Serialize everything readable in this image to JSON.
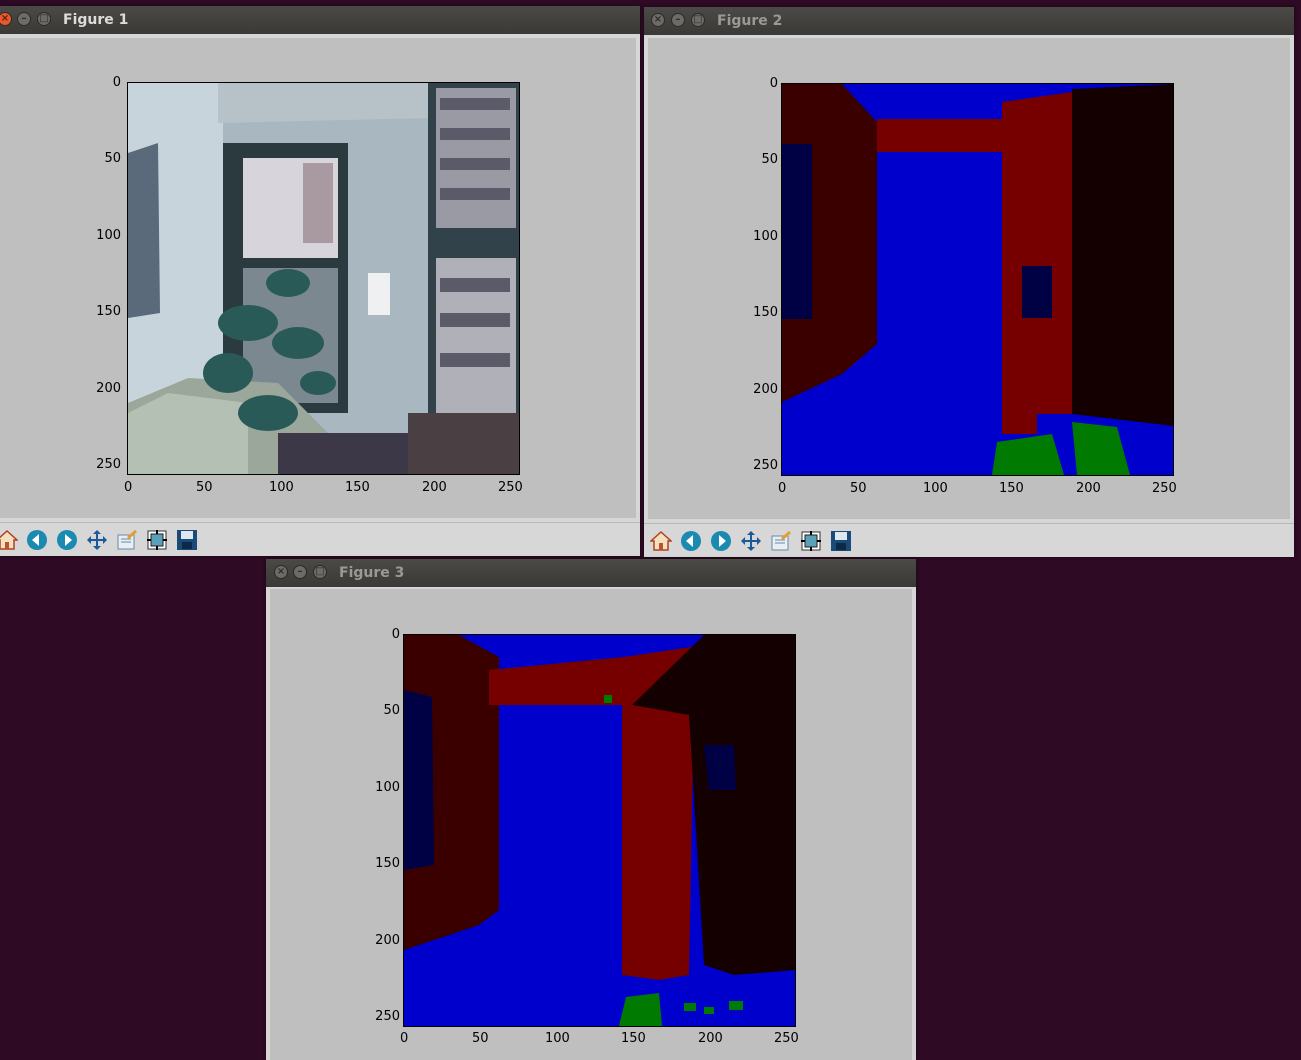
{
  "windows": [
    {
      "title": "Figure 1"
    },
    {
      "title": "Figure 2"
    },
    {
      "title": "Figure 3"
    }
  ],
  "axis": {
    "x_ticks": [
      "0",
      "50",
      "100",
      "150",
      "200",
      "250"
    ],
    "y_ticks": [
      "0",
      "50",
      "100",
      "150",
      "200",
      "250"
    ]
  },
  "toolbar_icons": [
    "home-icon",
    "back-icon",
    "forward-icon",
    "pan-icon",
    "zoom-icon",
    "subplots-icon",
    "save-icon"
  ],
  "colors": {
    "desktop": "#2e0a24",
    "class_blue": "#0000cc",
    "class_red": "#760000",
    "class_dark_red": "#3a0000",
    "class_near_black": "#140000",
    "class_green": "#007a00",
    "class_navy": "#000044"
  }
}
